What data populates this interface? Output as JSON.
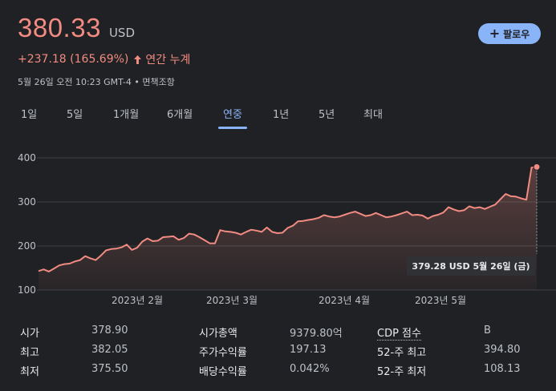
{
  "header": {
    "price": "380.33",
    "currency": "USD",
    "change": "+237.18 (165.69%)",
    "period_label": "연간 누계",
    "timestamp": "5월 26일 오전 10:23 GMT-4 • 면책조항",
    "follow_label": "팔로우"
  },
  "tabs": [
    {
      "label": "1일"
    },
    {
      "label": "5일"
    },
    {
      "label": "1개월"
    },
    {
      "label": "6개월"
    },
    {
      "label": "연중",
      "active": true
    },
    {
      "label": "1년"
    },
    {
      "label": "5년"
    },
    {
      "label": "최대"
    }
  ],
  "colors": {
    "accent": "#8ab4f8",
    "price": "#f28b82",
    "background": "#202124"
  },
  "chart_data": {
    "type": "area",
    "y_ticks": [
      "400",
      "300",
      "200",
      "100"
    ],
    "x_ticks": [
      "2023년 2월",
      "2023년 3월",
      "2023년 4월",
      "2023년 5월"
    ],
    "ylim": [
      100,
      400
    ],
    "series": [
      {
        "values": [
          143,
          147,
          142,
          149,
          156,
          159,
          160,
          165,
          168,
          177,
          172,
          168,
          178,
          190,
          193,
          194,
          197,
          203,
          191,
          196,
          210,
          217,
          211,
          212,
          220,
          221,
          222,
          214,
          218,
          228,
          226,
          220,
          213,
          206,
          206,
          236,
          233,
          232,
          230,
          226,
          232,
          237,
          235,
          232,
          242,
          232,
          229,
          230,
          241,
          246,
          256,
          257,
          259,
          261,
          264,
          270,
          267,
          265,
          267,
          271,
          275,
          278,
          273,
          268,
          270,
          275,
          270,
          265,
          267,
          270,
          274,
          278,
          270,
          271,
          269,
          262,
          268,
          271,
          276,
          288,
          283,
          279,
          281,
          290,
          286,
          288,
          284,
          289,
          294,
          306,
          318,
          313,
          312,
          308,
          305,
          378,
          379.28
        ]
      }
    ],
    "last_point_label": "379.28 USD  5월 26일 (금)"
  },
  "stats": {
    "col1": [
      {
        "label": "시가",
        "value": "378.90"
      },
      {
        "label": "최고",
        "value": "382.05"
      },
      {
        "label": "최저",
        "value": "375.50"
      }
    ],
    "col2": [
      {
        "label": "시가총액",
        "value": "9379.80억"
      },
      {
        "label": "주가수익률",
        "value": "197.13"
      },
      {
        "label": "배당수익률",
        "value": "0.042%"
      }
    ],
    "col3": [
      {
        "label": "CDP 점수",
        "value": "B"
      },
      {
        "label": "52-주 최고",
        "value": "394.80"
      },
      {
        "label": "52-주 최저",
        "value": "108.13"
      }
    ]
  }
}
